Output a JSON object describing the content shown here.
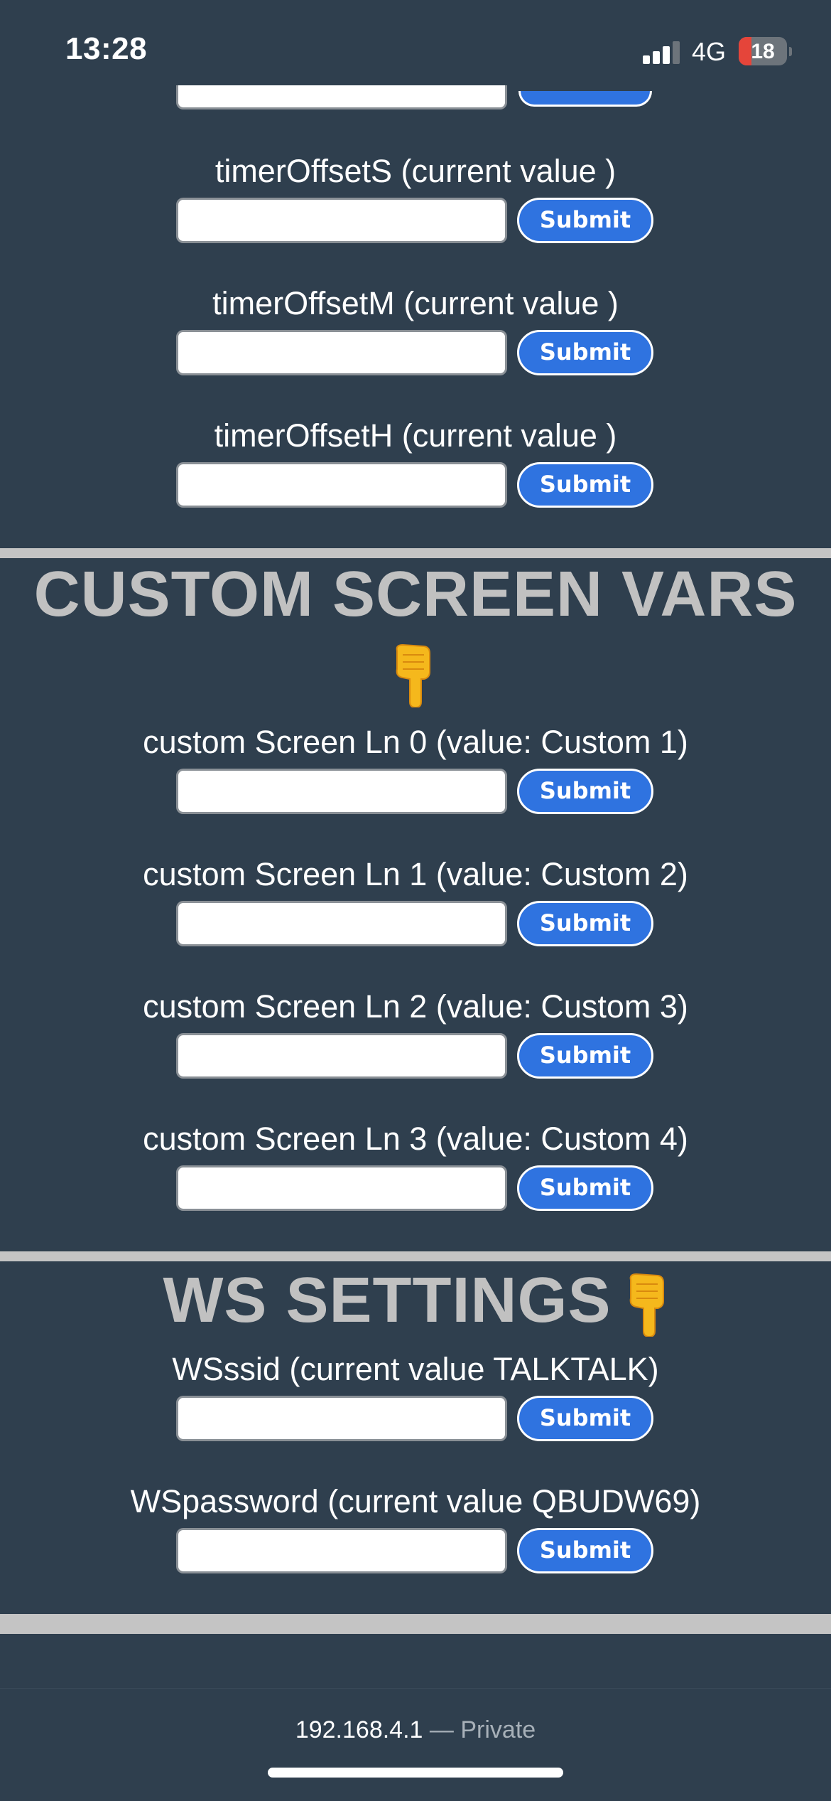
{
  "status_bar": {
    "time": "13:28",
    "network": "4G",
    "battery": "18",
    "battery_color": "#e5453a"
  },
  "timer_rows": [
    {
      "label": "timerOffsetS (current value )",
      "input_value": "",
      "button": "Submit"
    },
    {
      "label": "timerOffsetM (current value )",
      "input_value": "",
      "button": "Submit"
    },
    {
      "label": "timerOffsetH (current value )",
      "input_value": "",
      "button": "Submit"
    }
  ],
  "custom_section": {
    "heading": "CUSTOM SCREEN VARS",
    "icon": "backhand-index-pointing-down-icon",
    "rows": [
      {
        "label": "custom Screen Ln 0 (value: Custom 1)",
        "input_value": "",
        "button": "Submit"
      },
      {
        "label": "custom Screen Ln 1 (value: Custom 2)",
        "input_value": "",
        "button": "Submit"
      },
      {
        "label": "custom Screen Ln 2 (value: Custom 3)",
        "input_value": "",
        "button": "Submit"
      },
      {
        "label": "custom Screen Ln 3 (value: Custom 4)",
        "input_value": "",
        "button": "Submit"
      }
    ]
  },
  "ws_section": {
    "heading": "WS SETTINGS",
    "icon": "backhand-index-pointing-down-icon",
    "rows": [
      {
        "label": "WSssid (current value TALKTALK)",
        "input_value": "",
        "button": "Submit"
      },
      {
        "label": "WSpassword (current value QBUDW69)",
        "input_value": "",
        "button": "Submit"
      }
    ]
  },
  "browser": {
    "url": "192.168.4.1",
    "privacy": "— Private"
  },
  "colors": {
    "background": "#2f3f4e",
    "button": "#2f73e0",
    "heading": "#c1c1c1",
    "divider": "#c4c4c4"
  }
}
